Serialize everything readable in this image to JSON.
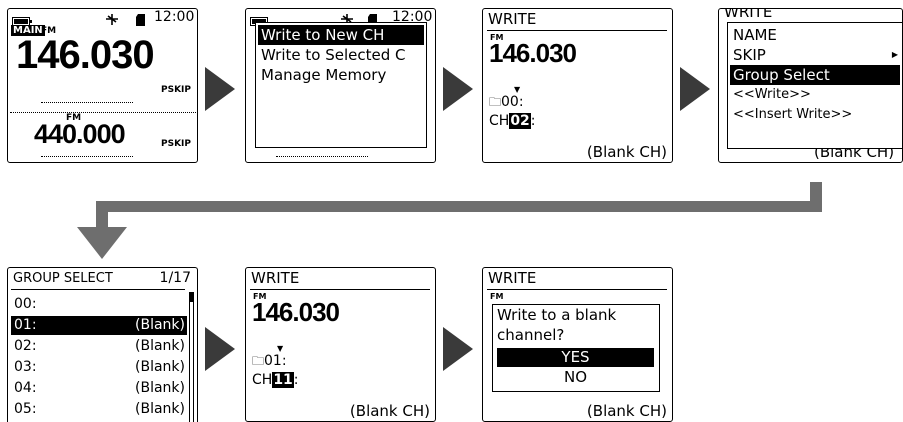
{
  "screen1": {
    "status_time": "12:00",
    "main_badge": "MAIN",
    "mode_top": "FM",
    "freq_top": "146.030",
    "pskip_top": "PSKIP",
    "mode_bottom": "FM",
    "freq_bottom": "440.000",
    "pskip_bottom": "PSKIP"
  },
  "screen2": {
    "status_time": "12:00",
    "menu": [
      "Write to New CH",
      "Write to Selected C",
      "Manage Memory"
    ],
    "selected_index": 0
  },
  "screen3": {
    "title": "WRITE",
    "mode": "FM",
    "freq": "146.030",
    "group": "00:",
    "ch_label": "CH",
    "ch_num": "02",
    "ch_suffix": ":",
    "blank": "(Blank CH)"
  },
  "screen4": {
    "title_partial": "WRITE",
    "menu": [
      "NAME",
      "SKIP",
      "Group Select",
      "<<Write>>",
      "<<Insert Write>>"
    ],
    "selected_index": 2,
    "blank": "(Blank CH)"
  },
  "screen5": {
    "title": "GROUP SELECT",
    "page": "1/17",
    "rows": [
      {
        "num": "00:",
        "val": ""
      },
      {
        "num": "01:",
        "val": "(Blank)"
      },
      {
        "num": "02:",
        "val": "(Blank)"
      },
      {
        "num": "03:",
        "val": "(Blank)"
      },
      {
        "num": "04:",
        "val": "(Blank)"
      },
      {
        "num": "05:",
        "val": "(Blank)"
      }
    ],
    "selected_index": 1
  },
  "screen6": {
    "title": "WRITE",
    "mode": "FM",
    "freq": "146.030",
    "group": "01:",
    "ch_label": "CH",
    "ch_num": "11",
    "ch_suffix": ":",
    "blank": "(Blank CH)"
  },
  "screen7": {
    "title": "WRITE",
    "mode": "FM",
    "question_line1": "Write to a blank",
    "question_line2": "channel?",
    "yes": "YES",
    "no": "NO",
    "blank": "(Blank CH)"
  },
  "colors": {
    "arrow": "#3a3a3a",
    "flow_connector": "#6e6e6e",
    "highlight": "#000000"
  }
}
